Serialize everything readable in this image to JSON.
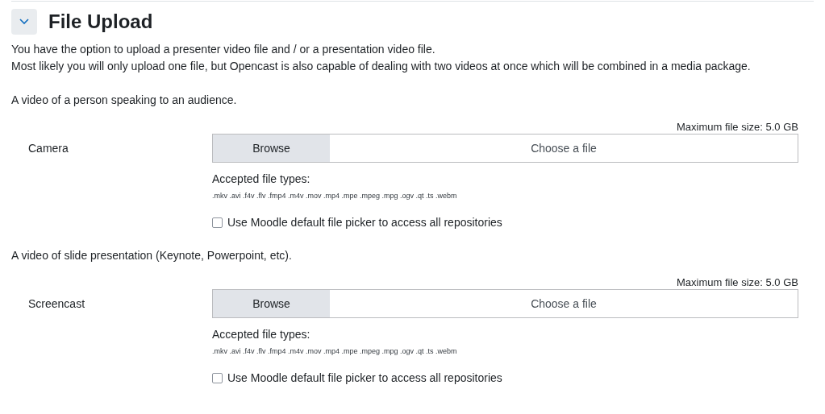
{
  "section": {
    "title": "File Upload",
    "expanded": true
  },
  "intro": [
    "You have the option to upload a presenter video file and / or a presentation video file.",
    "Most likely you will only upload one file, but Opencast is also capable of dealing with two videos at once which will be combined in a media package."
  ],
  "uploads": [
    {
      "description": "A video of a person speaking to an audience.",
      "label": "Camera",
      "max_size": "Maximum file size: 5.0 GB",
      "browse": "Browse",
      "placeholder": "Choose a file",
      "accepted_label": "Accepted file types:",
      "types": ".mkv .avi .f4v .flv .fmp4 .m4v .mov .mp4 .mpe .mpeg .mpg .ogv .qt .ts .webm",
      "checkbox": {
        "label": "Use Moodle default file picker to access all repositories",
        "checked": false
      }
    },
    {
      "description": "A video of slide presentation (Keynote, Powerpoint, etc).",
      "label": "Screencast",
      "max_size": "Maximum file size: 5.0 GB",
      "browse": "Browse",
      "placeholder": "Choose a file",
      "accepted_label": "Accepted file types:",
      "types": ".mkv .avi .f4v .flv .fmp4 .m4v .mov .mp4 .mpe .mpeg .mpg .ogv .qt .ts .webm",
      "checkbox": {
        "label": "Use Moodle default file picker to access all repositories",
        "checked": false
      }
    }
  ]
}
